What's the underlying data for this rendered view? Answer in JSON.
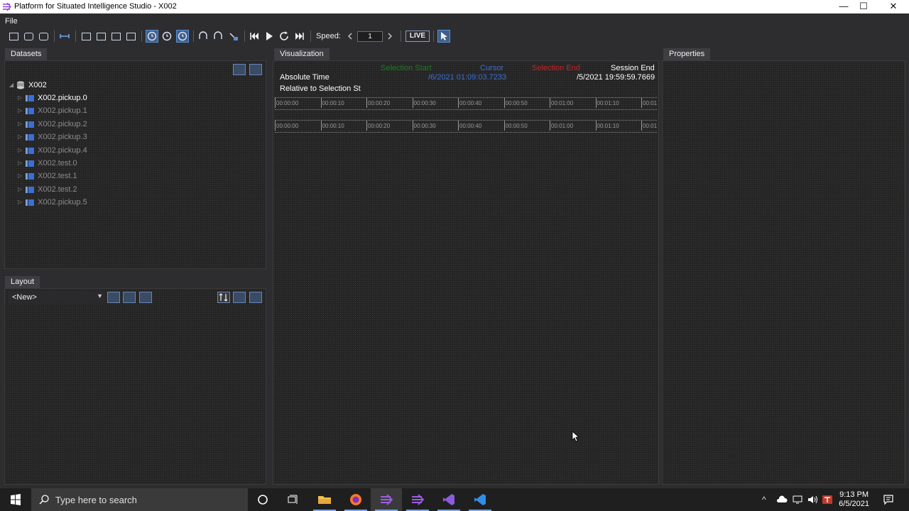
{
  "window": {
    "title": "Platform for Situated Intelligence Studio - X002",
    "minimize": "—",
    "maximize": "☐",
    "close": "✕"
  },
  "menu": {
    "file": "File"
  },
  "toolbar": {
    "speed_label": "Speed:",
    "speed_value": "1",
    "live_label": "LIVE"
  },
  "datasets": {
    "tab_label": "Datasets",
    "root": "X002",
    "items": [
      "X002.pickup.0",
      "X002.pickup.1",
      "X002.pickup.2",
      "X002.pickup.3",
      "X002.pickup.4",
      "X002.test.0",
      "X002.test.1",
      "X002.test.2",
      "X002.pickup.5"
    ]
  },
  "layout": {
    "tab_label": "Layout",
    "selected": "<New>"
  },
  "visualization": {
    "tab_label": "Visualization",
    "selection_start_label": "Selection Start",
    "cursor_label": "Cursor",
    "selection_end_label": "Selection End",
    "session_end_label": "Session End",
    "absolute_time_label": "Absolute Time",
    "cursor_value": "/6/2021 01:09:03.7233",
    "session_end_value": "/5/2021 19:59:59.7669",
    "relative_label": "Relative to Selection St",
    "ruler_ticks": [
      "00:00:00",
      "00:00:10",
      "00:00:20",
      "00:00:30",
      "00:00:40",
      "00:00:50",
      "00:01:00",
      "00:01:10",
      "00:01"
    ],
    "colors": {
      "selection_start": "#1a7f1a",
      "cursor": "#3b6fd4",
      "selection_end": "#d02020"
    }
  },
  "properties": {
    "tab_label": "Properties"
  },
  "taskbar": {
    "search_placeholder": "Type here to search",
    "time": "9:13 PM",
    "date": "6/5/2021"
  }
}
